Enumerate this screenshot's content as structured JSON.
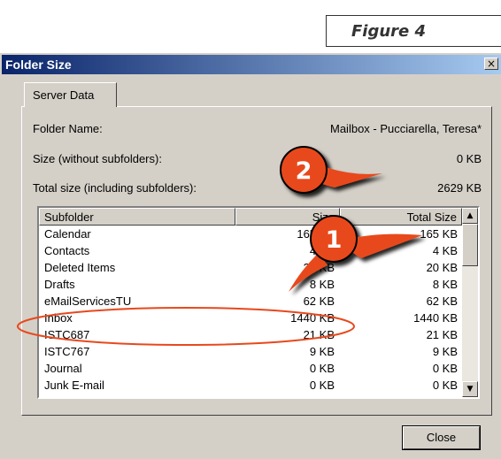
{
  "figure_label": "Figure 4",
  "window": {
    "title": "Folder Size",
    "close_glyph": "×"
  },
  "tab": {
    "label": "Server Data"
  },
  "fields": {
    "folder_name_label": "Folder Name:",
    "folder_name_value": "Mailbox - Pucciarella, Teresa*",
    "size_label": "Size (without subfolders):",
    "size_value": "0 KB",
    "total_label": "Total size (including subfolders):",
    "total_value": "2629 KB"
  },
  "table": {
    "headers": [
      "Subfolder",
      "Size",
      "Total Size"
    ],
    "rows": [
      {
        "name": "Calendar",
        "size": "165 KB",
        "total": "165 KB"
      },
      {
        "name": "Contacts",
        "size": "4 KB",
        "total": "4 KB"
      },
      {
        "name": "Deleted Items",
        "size": "20 KB",
        "total": "20 KB"
      },
      {
        "name": "Drafts",
        "size": "8 KB",
        "total": "8 KB"
      },
      {
        "name": "eMailServicesTU",
        "size": "62 KB",
        "total": "62 KB"
      },
      {
        "name": "Inbox",
        "size": "1440 KB",
        "total": "1440 KB"
      },
      {
        "name": "ISTC687",
        "size": "21 KB",
        "total": "21 KB"
      },
      {
        "name": "ISTC767",
        "size": "9 KB",
        "total": "9 KB"
      },
      {
        "name": "Journal",
        "size": "0 KB",
        "total": "0 KB"
      },
      {
        "name": "Junk E-mail",
        "size": "0 KB",
        "total": "0 KB"
      }
    ]
  },
  "scrollbar": {
    "up_glyph": "▲",
    "down_glyph": "▼"
  },
  "buttons": {
    "close_label": "Close"
  },
  "annotations": {
    "badge_1": "1",
    "badge_2": "2",
    "badge_color": "#e8481c",
    "highlight_color": "#e8481c"
  }
}
